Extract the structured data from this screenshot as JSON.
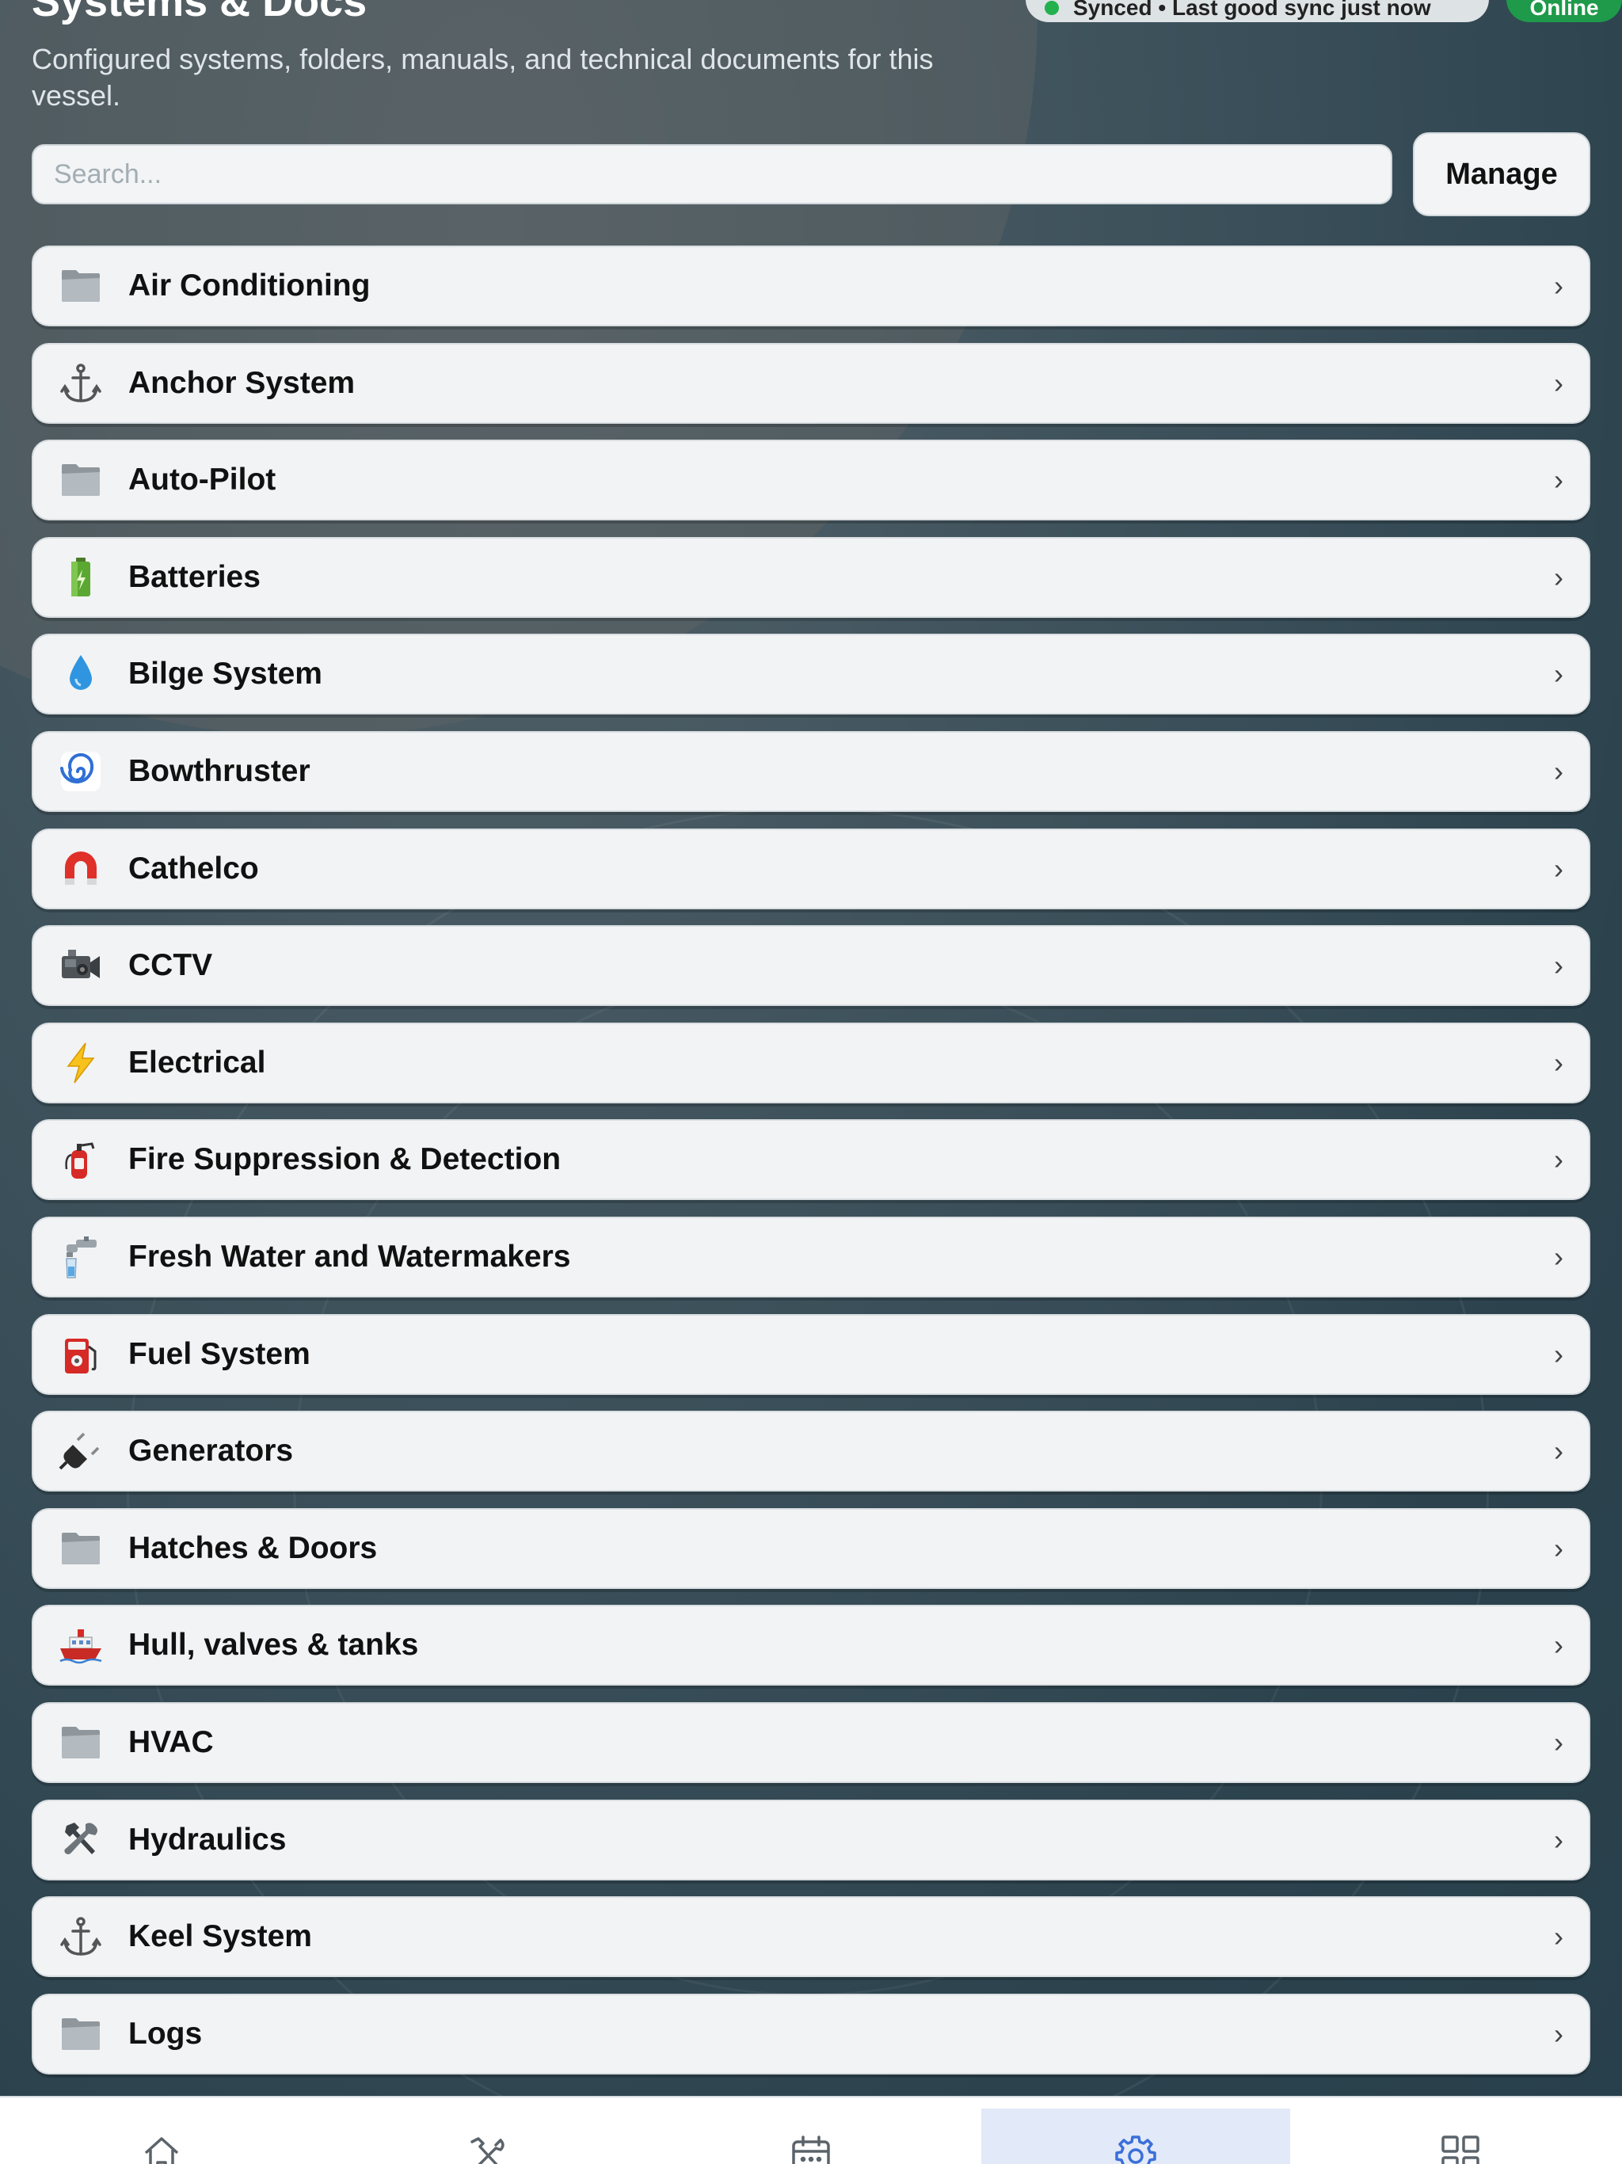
{
  "header": {
    "title": "Systems & Docs",
    "subtitle": "Configured systems, folders, manuals, and technical documents for this vessel.",
    "sync_status": "Synced • Last good sync just now",
    "online_label": "Online"
  },
  "search": {
    "placeholder": "Search...",
    "value": ""
  },
  "manage_button": {
    "label": "Manage"
  },
  "systems": [
    {
      "label": "Air Conditioning",
      "icon": "folder-icon"
    },
    {
      "label": "Anchor System",
      "icon": "anchor-icon"
    },
    {
      "label": "Auto-Pilot",
      "icon": "folder-icon"
    },
    {
      "label": "Batteries",
      "icon": "battery-icon"
    },
    {
      "label": "Bilge System",
      "icon": "droplet-icon"
    },
    {
      "label": "Bowthruster",
      "icon": "cyclone-icon"
    },
    {
      "label": "Cathelco",
      "icon": "magnet-icon"
    },
    {
      "label": "CCTV",
      "icon": "video-camera-icon"
    },
    {
      "label": "Electrical",
      "icon": "lightning-icon"
    },
    {
      "label": "Fire Suppression & Detection",
      "icon": "fire-extinguisher-icon"
    },
    {
      "label": "Fresh Water and Watermakers",
      "icon": "faucet-icon"
    },
    {
      "label": "Fuel System",
      "icon": "fuel-pump-icon"
    },
    {
      "label": "Generators",
      "icon": "plug-icon"
    },
    {
      "label": "Hatches & Doors",
      "icon": "folder-icon"
    },
    {
      "label": "Hull, valves & tanks",
      "icon": "ship-icon"
    },
    {
      "label": "HVAC",
      "icon": "folder-icon"
    },
    {
      "label": "Hydraulics",
      "icon": "tools-icon"
    },
    {
      "label": "Keel System",
      "icon": "anchor-icon"
    },
    {
      "label": "Logs",
      "icon": "folder-icon"
    }
  ],
  "tab_bar": {
    "tabs": [
      {
        "icon": "home-icon",
        "active": false
      },
      {
        "icon": "tools-icon",
        "active": false
      },
      {
        "icon": "calendar-icon",
        "active": false
      },
      {
        "icon": "gear-icon",
        "active": true
      },
      {
        "icon": "grid-icon",
        "active": false
      }
    ],
    "active_color": "#3a6fd8"
  },
  "colors": {
    "online": "#1e9a4a",
    "sync_dot": "#22b14c",
    "accent": "#3a6fd8"
  }
}
